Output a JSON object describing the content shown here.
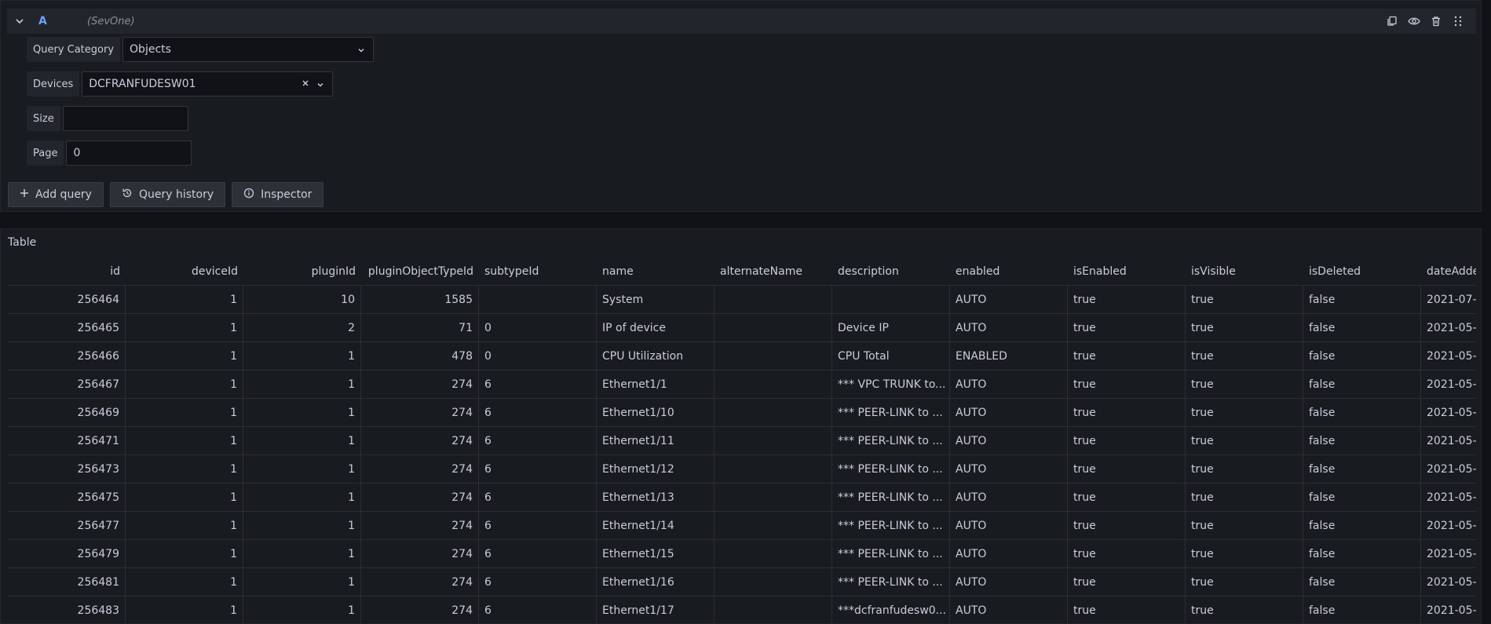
{
  "query": {
    "letter": "A",
    "datasource": "(SevOne)",
    "fields": {
      "category_label": "Query Category",
      "category_value": "Objects",
      "devices_label": "Devices",
      "devices_value": "DCFRANFUDESW01",
      "size_label": "Size",
      "size_value": "",
      "page_label": "Page",
      "page_value": "0"
    },
    "buttons": {
      "add_query": "Add query",
      "query_history": "Query history",
      "inspector": "Inspector"
    }
  },
  "table": {
    "title": "Table",
    "columns": [
      "id",
      "deviceId",
      "pluginId",
      "pluginObjectTypeId",
      "subtypeId",
      "name",
      "alternateName",
      "description",
      "enabled",
      "isEnabled",
      "isVisible",
      "isDeleted",
      "dateAdde"
    ],
    "rows": [
      [
        "256464",
        "1",
        "10",
        "1585",
        "",
        "System",
        "",
        "",
        "AUTO",
        "true",
        "true",
        "false",
        "2021-07-"
      ],
      [
        "256465",
        "1",
        "2",
        "71",
        "0",
        "IP of device",
        "",
        "Device IP",
        "AUTO",
        "true",
        "true",
        "false",
        "2021-05-"
      ],
      [
        "256466",
        "1",
        "1",
        "478",
        "0",
        "CPU Utilization",
        "",
        "CPU Total",
        "ENABLED",
        "true",
        "true",
        "false",
        "2021-05-"
      ],
      [
        "256467",
        "1",
        "1",
        "274",
        "6",
        "Ethernet1/1",
        "",
        "*** VPC TRUNK to...",
        "AUTO",
        "true",
        "true",
        "false",
        "2021-05-"
      ],
      [
        "256469",
        "1",
        "1",
        "274",
        "6",
        "Ethernet1/10",
        "",
        "*** PEER-LINK to ...",
        "AUTO",
        "true",
        "true",
        "false",
        "2021-05-"
      ],
      [
        "256471",
        "1",
        "1",
        "274",
        "6",
        "Ethernet1/11",
        "",
        "*** PEER-LINK to ...",
        "AUTO",
        "true",
        "true",
        "false",
        "2021-05-"
      ],
      [
        "256473",
        "1",
        "1",
        "274",
        "6",
        "Ethernet1/12",
        "",
        "*** PEER-LINK to ...",
        "AUTO",
        "true",
        "true",
        "false",
        "2021-05-"
      ],
      [
        "256475",
        "1",
        "1",
        "274",
        "6",
        "Ethernet1/13",
        "",
        "*** PEER-LINK to ...",
        "AUTO",
        "true",
        "true",
        "false",
        "2021-05-"
      ],
      [
        "256477",
        "1",
        "1",
        "274",
        "6",
        "Ethernet1/14",
        "",
        "*** PEER-LINK to ...",
        "AUTO",
        "true",
        "true",
        "false",
        "2021-05-"
      ],
      [
        "256479",
        "1",
        "1",
        "274",
        "6",
        "Ethernet1/15",
        "",
        "*** PEER-LINK to ...",
        "AUTO",
        "true",
        "true",
        "false",
        "2021-05-"
      ],
      [
        "256481",
        "1",
        "1",
        "274",
        "6",
        "Ethernet1/16",
        "",
        "*** PEER-LINK to ...",
        "AUTO",
        "true",
        "true",
        "false",
        "2021-05-"
      ],
      [
        "256483",
        "1",
        "1",
        "274",
        "6",
        "Ethernet1/17",
        "",
        "***dcfranfudesw0...",
        "AUTO",
        "true",
        "true",
        "false",
        "2021-05-"
      ]
    ]
  },
  "icons": {
    "collapse": "chevron-down-icon",
    "copy": "copy-icon",
    "eye": "eye-icon",
    "trash": "trash-icon",
    "drag": "drag-handle-icon"
  },
  "colors": {
    "background": "#111217",
    "panel": "#181b1f",
    "accent": "#6e9fff"
  }
}
